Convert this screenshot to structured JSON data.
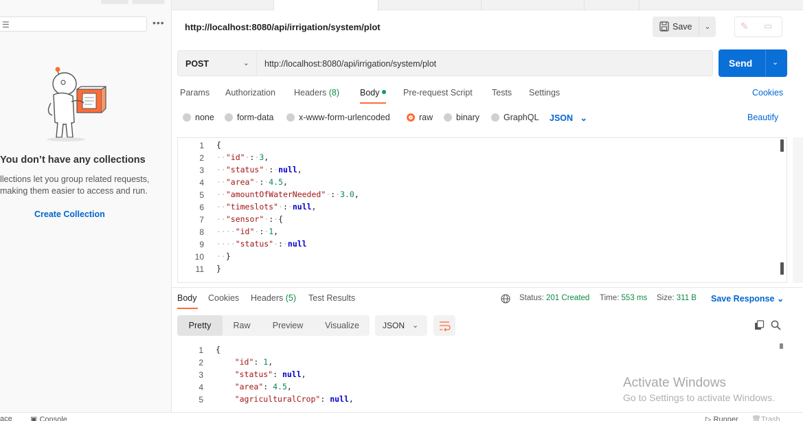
{
  "sidebar": {
    "empty_title": "You don’t have any collections",
    "empty_desc_line1": "llections let you group related requests,",
    "empty_desc_line2": "making them easier to access and run.",
    "create_label": "Create Collection"
  },
  "request": {
    "title": "http://localhost:8080/api/irrigation/system/plot",
    "save_label": "Save",
    "method": "POST",
    "url": "http://localhost:8080/api/irrigation/system/plot",
    "send_label": "Send",
    "tabs": [
      "Params",
      "Authorization",
      "Headers",
      "Body",
      "Pre-request Script",
      "Tests",
      "Settings"
    ],
    "headers_count": "(8)",
    "cookies_label": "Cookies",
    "body_types": [
      "none",
      "form-data",
      "x-www-form-urlencoded",
      "raw",
      "binary",
      "GraphQL"
    ],
    "body_format": "JSON",
    "beautify_label": "Beautify",
    "body_lines": [
      "1",
      "2",
      "3",
      "4",
      "5",
      "6",
      "7",
      "8",
      "9",
      "10",
      "11"
    ]
  },
  "response": {
    "tabs": [
      "Body",
      "Cookies",
      "Headers",
      "Test Results"
    ],
    "headers_count": "(5)",
    "status_label": "Status:",
    "status_value": "201 Created",
    "time_label": "Time:",
    "time_value": "553 ms",
    "size_label": "Size:",
    "size_value": "311 B",
    "save_response_label": "Save Response",
    "views": [
      "Pretty",
      "Raw",
      "Preview",
      "Visualize"
    ],
    "format": "JSON",
    "lines": [
      "1",
      "2",
      "3",
      "4",
      "5"
    ]
  },
  "watermark": {
    "line1": "Activate Windows",
    "line2": "Go to Settings to activate Windows."
  },
  "statusbar": {
    "left1": "ace",
    "console": "Console",
    "runner": "Runner",
    "trash": "Trash"
  },
  "colors": {
    "accent": "#ff6c37",
    "primary": "#0b6fd8",
    "link": "#0265d2",
    "success": "#0f8a42"
  }
}
